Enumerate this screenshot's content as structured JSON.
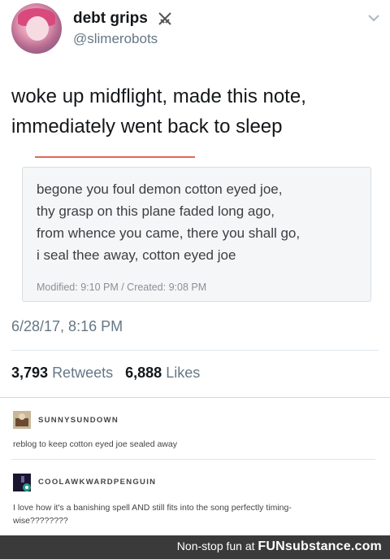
{
  "tweet": {
    "display_name": "debt grips",
    "name_icon": "crossed-swords-icon",
    "handle": "@slimerobots",
    "text_line1": "woke up midflight, made this note,",
    "text_line2": "immediately went back to sleep",
    "note": {
      "line1": "begone you foul demon cotton eyed joe,",
      "line2": "thy grasp on this plane faded long ago,",
      "line3": "from whence you came, there you shall go,",
      "line4": "i seal thee away, cotton eyed joe",
      "meta": "Modified: 9:10 PM / Created: 9:08 PM",
      "accent_color": "#e2685a"
    },
    "timestamp": "6/28/17, 8:16 PM",
    "retweets_count": "3,793",
    "retweets_label": "Retweets",
    "likes_count": "6,888",
    "likes_label": "Likes"
  },
  "reblogs": [
    {
      "username": "SUNNYSUNDOWN",
      "text": "reblog to keep cotton eyed joe sealed away"
    },
    {
      "username": "COOLAWKWARDPENGUIN",
      "text_line1": "I love how it's a banishing spell AND still fits into the song perfectly timing-",
      "text_line2": "wise????????"
    }
  ],
  "footer": {
    "prefix": "Non-stop fun at",
    "brand": "FUNsubstance.com"
  }
}
